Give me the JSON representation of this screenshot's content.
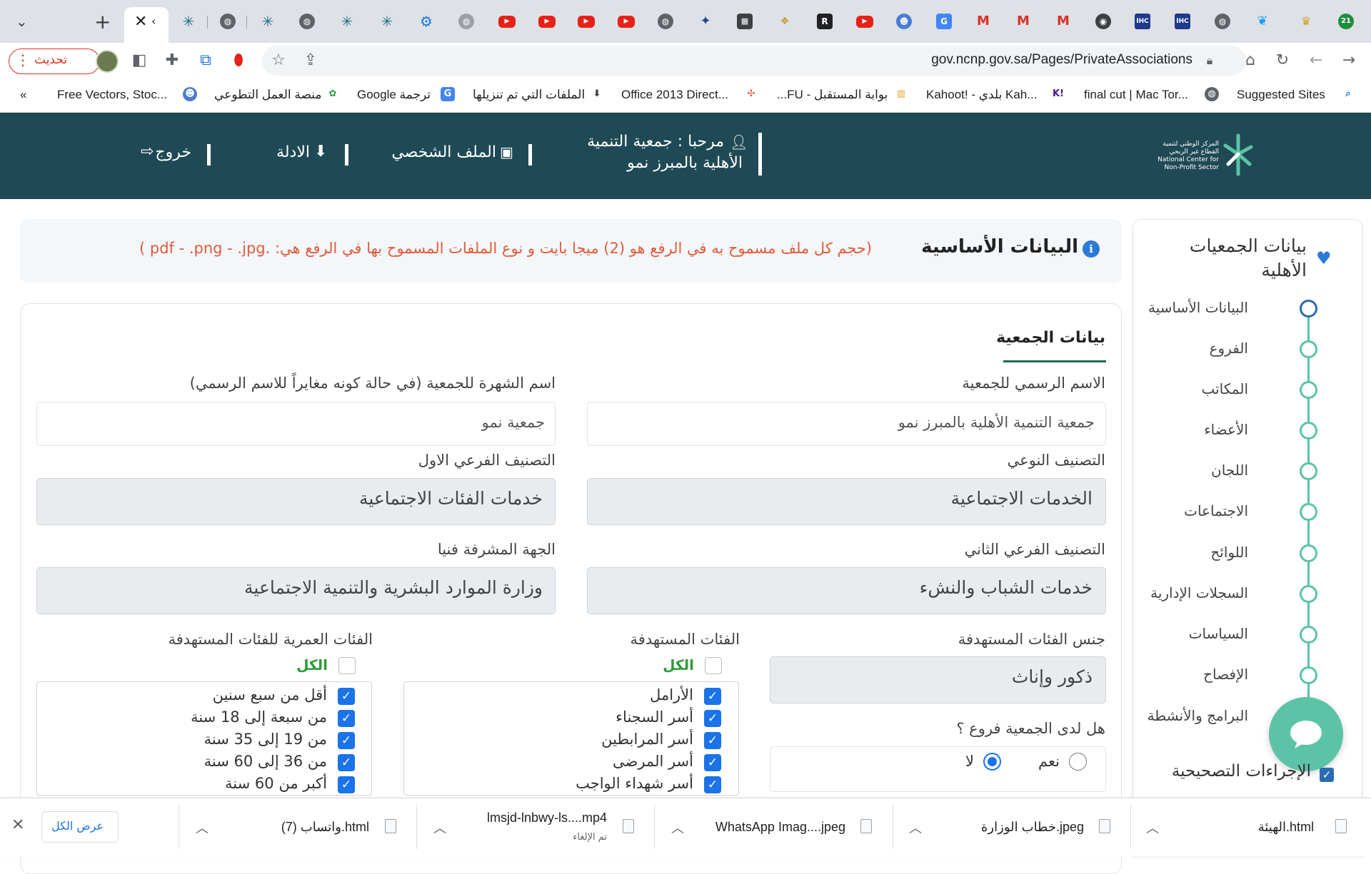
{
  "browser": {
    "url": "gov.ncnp.gov.sa/Pages/PrivateAssociations",
    "update_button": "تحديث",
    "tab_count_badge": "21",
    "bookmarks": [
      "Suggested Sites",
      "final cut | Mac Tor...",
      "Kahoot! - بلدي Kah...",
      "بوابة المستقبل - FU...",
      "Office 2013 Direct...",
      "الملفات التي تم تنزيلها",
      "ترجمة Google",
      "منصة العمل التطوعي",
      "Free Vectors, Stoc..."
    ],
    "bookmarks_overflow": "«"
  },
  "header": {
    "logo_text": "المركز الوطني لتنمية القطاع غير الربحي National Center for Non-Profit Sector",
    "welcome_line1": "مرحبا : جمعية التنمية",
    "welcome_line2": "الأهلية بالمبرز نمو",
    "profile_link": "الملف الشخصي",
    "guides_link": "الادلة",
    "logout_link": "خروج"
  },
  "sidebar": {
    "title": "بيانات الجمعيات الأهلية",
    "steps": [
      "البيانات الأساسية",
      "الفروع",
      "المكاتب",
      "الأعضاء",
      "اللجان",
      "الاجتماعات",
      "اللوائح",
      "السجلات الإدارية",
      "السياسات",
      "الإفصاح",
      "البرامج والأنشطة"
    ],
    "corrective_actions": "الإجراءات التصحيحية"
  },
  "banner": {
    "title": "البيانات الأساسية",
    "note": "(حجم كل ملف مسموح به في الرفع هو (2) ميجا بايت و نوع الملفات المسموح بها في الرفع هي: .pdf - .png - .jpg )"
  },
  "form": {
    "section_title": "بيانات الجمعية",
    "official_name_label": "الاسم الرسمي للجمعية",
    "official_name_value": "جمعية التنمية الأهلية بالمبرز نمو",
    "popular_name_label": "اسم الشهرة للجمعية (في حالة كونه مغايراً للاسم الرسمي)",
    "popular_name_value": "جمعية نمو",
    "type_class_label": "التصنيف النوعي",
    "type_class_value": "الخدمات الاجتماعية",
    "sub_class1_label": "التصنيف الفرعي الاول",
    "sub_class1_value": "خدمات الفئات الاجتماعية",
    "sub_class2_label": "التصنيف الفرعي الثاني",
    "sub_class2_value": "خدمات الشباب والنشء",
    "supervisor_label": "الجهة المشرفة فنيا",
    "supervisor_value": "وزارة الموارد البشرية والتنمية الاجتماعية",
    "gender_label": "جنس الفئات المستهدفة",
    "gender_value": "ذكور وإناث",
    "branches_question": "هل لدى الجمعية فروع ؟",
    "branches_yes": "نعم",
    "branches_no": "لا",
    "branches_selected": "no",
    "target_groups_label": "الفئات المستهدفة",
    "all_label": "الكل",
    "target_groups": [
      "الأرامل",
      "أسر السجناء",
      "أسر المرابطين",
      "أسر المرضى",
      "أسر شهداء الواجب"
    ],
    "age_groups_label": "الفئات العمرية للفئات المستهدفة",
    "age_groups": [
      "أقل من سبع سنين",
      "من سبعة إلى 18 سنة",
      "من 19 إلى 35 سنة",
      "من 36 إلى 60 سنة",
      "أكبر من 60 سنة"
    ]
  },
  "downloads": {
    "items": [
      {
        "name": "الهيئة.html"
      },
      {
        "name": "خطاب الوزارة.jpeg"
      },
      {
        "name": "WhatsApp Imag....jpeg"
      },
      {
        "name": "lmsjd-lnbwy-ls....mp4",
        "status": "تم الإلغاء"
      },
      {
        "name": "واتساب (7).html"
      }
    ],
    "show_all": "عرض الكل"
  },
  "colors": {
    "header_bg": "#1f4a55",
    "accent_teal": "#5cc3a7",
    "note_orange": "#e05b3a",
    "all_green": "#2e9b3a",
    "checkbox_blue": "#1a73e8"
  }
}
